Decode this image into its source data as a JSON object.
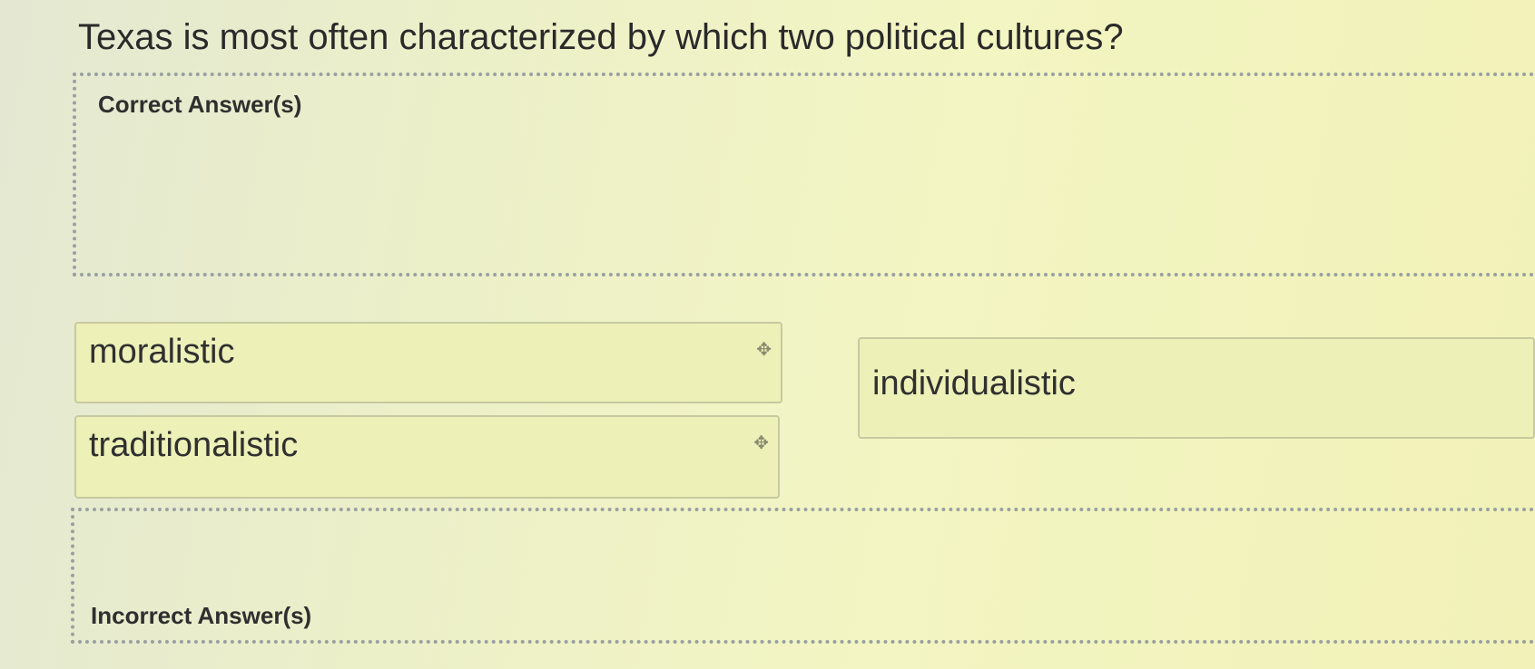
{
  "question": {
    "text": "Texas is most often characterized by which two political cultures?"
  },
  "zones": {
    "correct_label": "Correct Answer(s)",
    "incorrect_label": "Incorrect Answer(s)"
  },
  "choices": [
    {
      "label": "moralistic",
      "handle_icon": "move-handle-icon"
    },
    {
      "label": "traditionalistic",
      "handle_icon": "move-handle-icon"
    },
    {
      "label": "individualistic",
      "handle_icon": ""
    }
  ],
  "icons": {
    "move_handle_glyph": "✥"
  },
  "colors": {
    "chip_background": "#edf0b7",
    "chip_border": "#c7c9a0",
    "dropzone_border": "#9aa0a0"
  }
}
